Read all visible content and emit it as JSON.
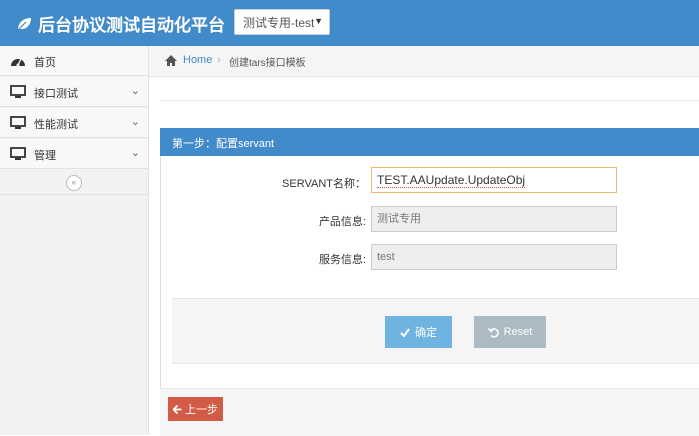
{
  "app": {
    "title": "后台协议测试自动化平台",
    "env_select_value": "测试专用-test"
  },
  "sidebar": {
    "items": [
      {
        "label": "首页",
        "icon": "dashboard-icon"
      },
      {
        "label": "接口测试",
        "icon": "desktop-icon"
      },
      {
        "label": "性能测试",
        "icon": "desktop-icon"
      },
      {
        "label": "管理",
        "icon": "desktop-icon"
      }
    ],
    "collapse_glyph": "«"
  },
  "breadcrumb": {
    "home": "Home",
    "separator": "›",
    "current": "创建tars接口模板"
  },
  "panel": {
    "title": "第一步：配置servant"
  },
  "form": {
    "servant_label": "SERVANT名称：",
    "servant_value": "TEST.AAUpdate.UpdateObj",
    "product_label": "产品信息:",
    "product_value": "测试专用",
    "service_label": "服务信息:",
    "service_value": "test"
  },
  "actions": {
    "confirm_label": "确定",
    "reset_label": "Reset",
    "prev_label": "上一步"
  },
  "colors": {
    "primary": "#428bca",
    "confirm": "#6fb3e0",
    "reset": "#abbac3",
    "prev": "#d15b47"
  }
}
